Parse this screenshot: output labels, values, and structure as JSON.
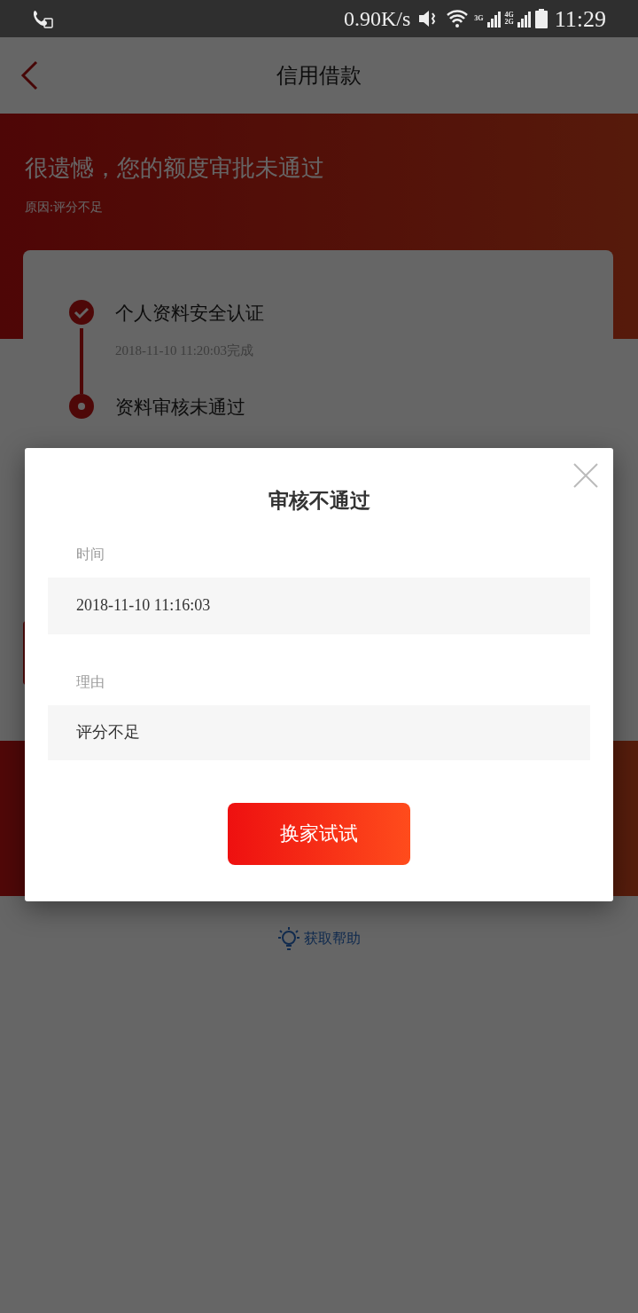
{
  "status_bar": {
    "speed": "0.90K/s",
    "network_labels": [
      "3G",
      "4G",
      "2G"
    ],
    "time": "11:29"
  },
  "nav": {
    "title": "信用借款"
  },
  "header": {
    "title": "很遗憾，您的额度审批未通过",
    "reason": "原因:评分不足"
  },
  "steps": [
    {
      "kind": "done",
      "title": "个人资料安全认证",
      "detail": "2018-11-10 11:20:03完成"
    },
    {
      "kind": "failed",
      "title": "资料审核未通过"
    }
  ],
  "help": {
    "label": "获取帮助"
  },
  "dialog": {
    "title": "审核不通过",
    "fields": [
      {
        "label": "时间",
        "value": "2018-11-10 11:16:03"
      },
      {
        "label": "理由",
        "value": "评分不足"
      }
    ],
    "button": "换家试试"
  }
}
